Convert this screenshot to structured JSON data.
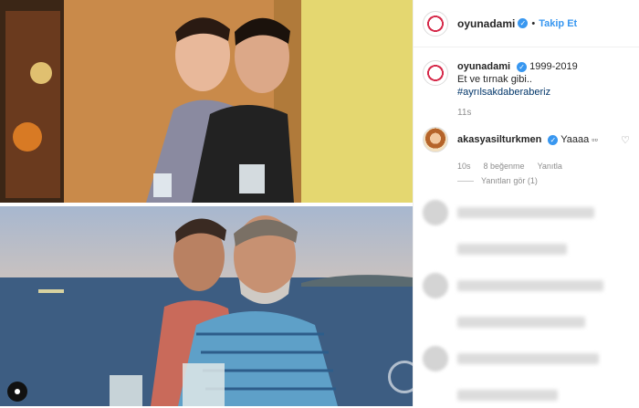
{
  "post": {
    "username": "oyunadami",
    "follow_label": "Takip Et",
    "separator": "•",
    "caption_line1": "1999-2019",
    "caption_line2": "Et ve tırnak gibi..",
    "hashtag": "#ayrılsakdaberaberiz",
    "time_ago": "11s"
  },
  "comment": {
    "username": "akasyasilturkmen",
    "text": "Yaaaa",
    "time_ago": "10s",
    "likes": "8 beğenme",
    "reply_label": "Yanıtla",
    "view_replies_label": "Yanıtları gör (1)"
  },
  "colors": {
    "link": "#3897f0",
    "hashtag": "#003569",
    "muted": "#8e8e8e"
  },
  "icons": {
    "verified": "verified-badge-icon",
    "heart": "heart-icon",
    "user": "user-circle-icon"
  }
}
